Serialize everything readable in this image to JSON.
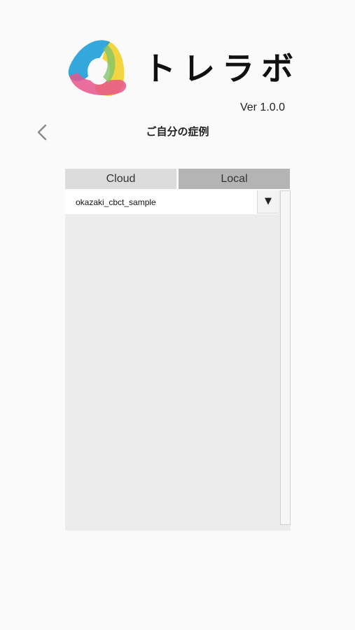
{
  "app": {
    "logo_text": "トレラボ",
    "version": "Ver 1.0.0"
  },
  "header": {
    "title": "ご自分の症例"
  },
  "tabs": [
    {
      "label": "Cloud",
      "selected": false
    },
    {
      "label": "Local",
      "selected": true
    }
  ],
  "cases": [
    {
      "name": "okazaki_cbct_sample"
    }
  ],
  "dropdown": {
    "symbol": "▼"
  },
  "colors": {
    "logo_blue": "#1e9fd8",
    "logo_pink": "#e8548c",
    "logo_yellow": "#f2d02e",
    "tab_selected": "#b4b4b4",
    "tab_unselected": "#dcdcdc"
  }
}
